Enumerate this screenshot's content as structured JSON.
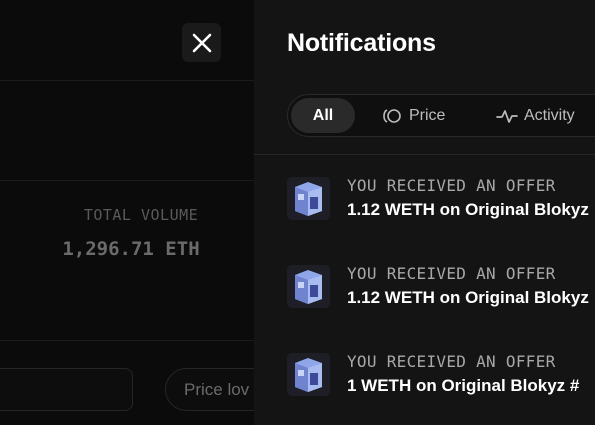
{
  "background": {
    "stat_label": "TOTAL VOLUME",
    "stat_value": "1,296.71 ETH",
    "sort_label": "Price lov"
  },
  "close_icon": "close-icon",
  "panel": {
    "title": "Notifications",
    "tabs": [
      {
        "label": "All",
        "icon": "",
        "selected": true
      },
      {
        "label": "Price",
        "icon": "price-icon",
        "selected": false
      },
      {
        "label": "Activity",
        "icon": "activity-icon",
        "selected": false
      }
    ],
    "notifications": [
      {
        "type": "YOU RECEIVED AN OFFER",
        "description": "1.12 WETH on Original Blokyz",
        "icon": "nft-thumbnail"
      },
      {
        "type": "YOU RECEIVED AN OFFER",
        "description": "1.12 WETH on Original Blokyz",
        "icon": "nft-thumbnail"
      },
      {
        "type": "YOU RECEIVED AN OFFER",
        "description": "1 WETH on Original Blokyz #",
        "icon": "nft-thumbnail"
      }
    ]
  },
  "colors": {
    "panel_bg": "#141414",
    "page_bg": "#0a0a0a",
    "selected_tab_bg": "#2a2a2a",
    "muted_text": "#a8a8a8"
  }
}
